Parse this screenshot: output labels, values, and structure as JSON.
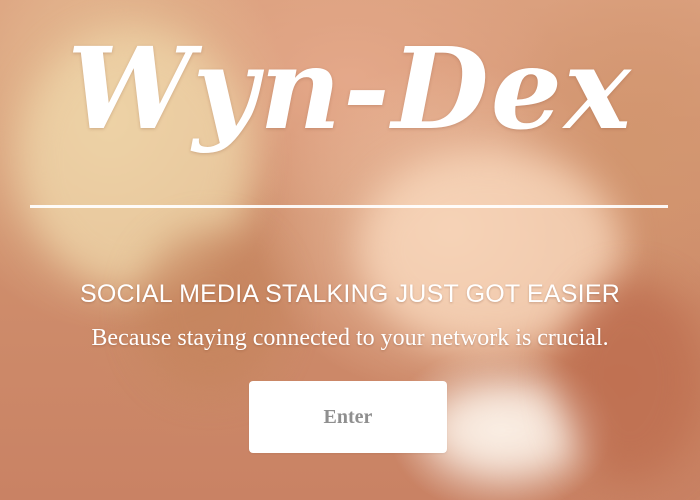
{
  "brand": {
    "logo_text": "Wyn-Dex"
  },
  "hero": {
    "tagline": "SOCIAL MEDIA STALKING JUST GOT EASIER",
    "subtitle": "Because staying connected to your network is crucial.",
    "enter_label": "Enter"
  },
  "colors": {
    "text": "#ffffff",
    "button_bg": "#ffffff",
    "button_text": "#8f8f8f"
  }
}
